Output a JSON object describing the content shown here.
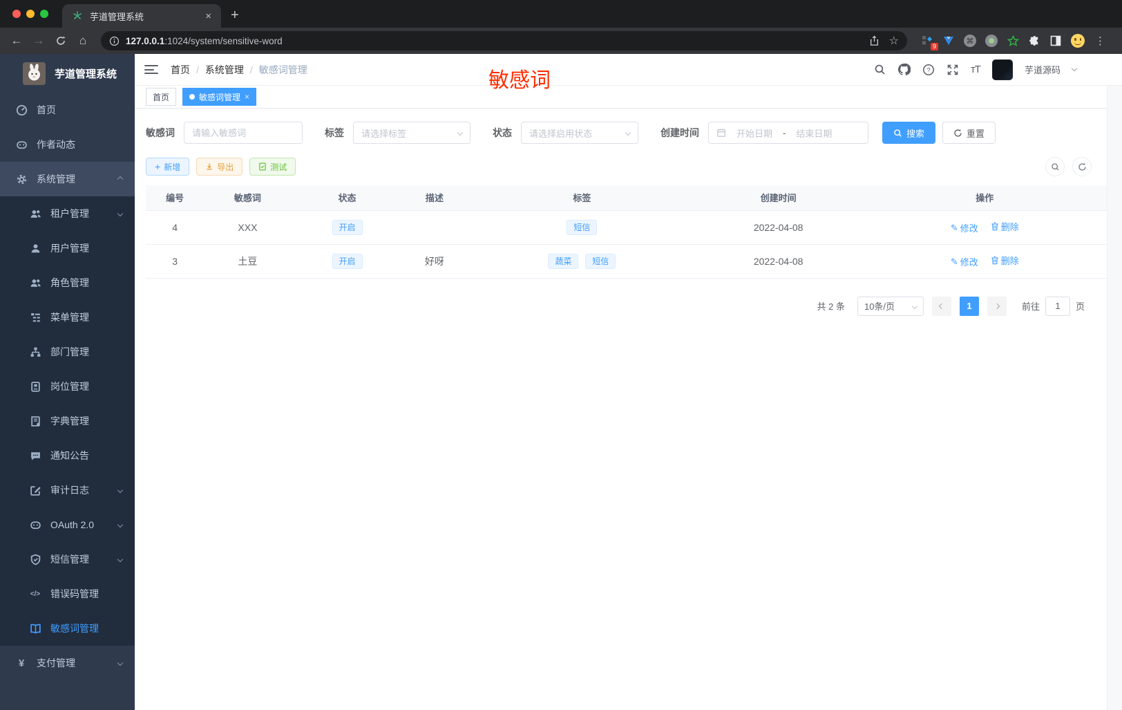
{
  "browser": {
    "tab_title": "芋道管理系统",
    "url_host": "127.0.0.1",
    "url_path": ":1024/system/sensitive-word",
    "extension_badge": "9"
  },
  "icons": {
    "close": "×",
    "new_tab": "+",
    "back": "←",
    "forward": "→",
    "home_glyph": "⌂",
    "star": "☆",
    "more": "⋮",
    "question": "?",
    "font_size": "тT",
    "command": "⌘",
    "edit_pencil": "✎",
    "yen": "¥",
    "code": "</>",
    "slash": "/"
  },
  "sidebar": {
    "title": "芋道管理系统",
    "items": [
      {
        "label": "首页"
      },
      {
        "label": "作者动态"
      },
      {
        "label": "系统管理"
      },
      {
        "label": "租户管理"
      },
      {
        "label": "用户管理"
      },
      {
        "label": "角色管理"
      },
      {
        "label": "菜单管理"
      },
      {
        "label": "部门管理"
      },
      {
        "label": "岗位管理"
      },
      {
        "label": "字典管理"
      },
      {
        "label": "通知公告"
      },
      {
        "label": "审计日志"
      },
      {
        "label": "OAuth 2.0"
      },
      {
        "label": "短信管理"
      },
      {
        "label": "错误码管理"
      },
      {
        "label": "敏感词管理"
      },
      {
        "label": "支付管理"
      }
    ]
  },
  "navbar": {
    "breadcrumb": [
      "首页",
      "系统管理",
      "敏感词管理"
    ],
    "separator": "/",
    "username": "芋道源码",
    "overlay_text": "敏感词"
  },
  "tabs": [
    {
      "label": "首页"
    },
    {
      "label": "敏感词管理"
    }
  ],
  "filters": {
    "keyword_label": "敏感词",
    "keyword_placeholder": "请输入敏感词",
    "tag_label": "标签",
    "tag_placeholder": "请选择标签",
    "status_label": "状态",
    "status_placeholder": "请选择启用状态",
    "date_label": "创建时间",
    "date_start_placeholder": "开始日期",
    "date_separator": "-",
    "date_end_placeholder": "结束日期",
    "search_label": "搜索",
    "reset_label": "重置"
  },
  "toolbar": {
    "add_label": "新增",
    "export_label": "导出",
    "test_label": "测试"
  },
  "table": {
    "headers": [
      "编号",
      "敏感词",
      "状态",
      "描述",
      "标签",
      "创建时间",
      "操作"
    ],
    "rows": [
      {
        "id": "4",
        "word": "XXX",
        "status": "开启",
        "description": "",
        "tags": [
          "短信"
        ],
        "create_time": "2022-04-08"
      },
      {
        "id": "3",
        "word": "土豆",
        "status": "开启",
        "description": "好呀",
        "tags": [
          "蔬菜",
          "短信"
        ],
        "create_time": "2022-04-08"
      }
    ],
    "edit_label": "修改",
    "delete_label": "删除"
  },
  "pagination": {
    "total_text": "共 2 条",
    "page_size": "10条/页",
    "current_page": "1",
    "goto_label": "前往",
    "goto_value": "1",
    "page_unit": "页"
  },
  "colors": {
    "accent": "#409eff",
    "overlay_red": "#ff2d02",
    "warning": "#e6a23c",
    "success": "#67c23a",
    "sidebar_bg": "#2f3a4d",
    "submenu_bg": "#212c3d"
  }
}
